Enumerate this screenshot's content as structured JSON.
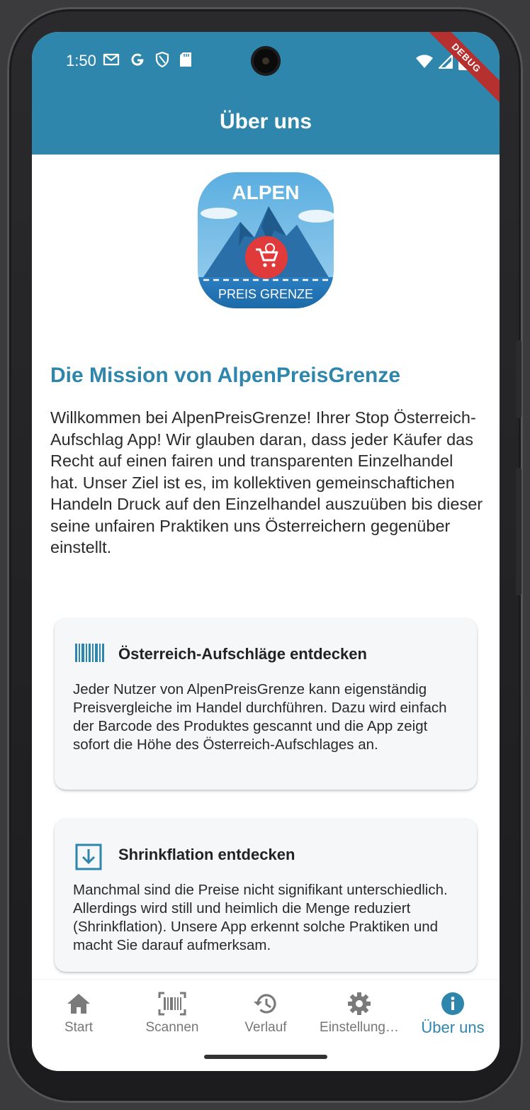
{
  "status_bar": {
    "time": "1:50",
    "icons": [
      "mail-icon",
      "google-icon",
      "shield-icon",
      "sd-card-icon",
      "wifi-icon",
      "signal-icon",
      "battery-icon"
    ],
    "debug_banner": "DEBUG"
  },
  "app_bar": {
    "title": "Über uns"
  },
  "colors": {
    "primary": "#2e86ad",
    "debug": "#b5302f",
    "card_bg": "#f6f7f9"
  },
  "logo": {
    "top_text": "ALPEN",
    "bottom_text": "PREIS GRENZE"
  },
  "mission": {
    "title": "Die Mission von AlpenPreisGrenze",
    "text": "Willkommen bei AlpenPreisGrenze! Ihrer Stop Österreich-Aufschlag App! Wir glauben daran, dass jeder Käufer das Recht auf einen fairen und transparenten Einzelhandel hat. Unser Ziel ist es, im kollektiven gemeinschaftichen Handeln Druck auf den Einzelhandel auszuüben bis dieser seine unfairen Praktiken uns Österreichern gegenüber einstellt."
  },
  "cards": [
    {
      "icon": "barcode-icon",
      "title": "Österreich-Aufschläge entdecken",
      "text": "Jeder Nutzer von AlpenPreisGrenze kann eigenständig Preisvergleiche im Handel durchführen. Dazu wird einfach der Barcode des Produktes gescannt und die App zeigt sofort die Höhe des Österreich-Aufschlages an."
    },
    {
      "icon": "download-box-icon",
      "title": "Shrinkflation entdecken",
      "text": "Manchmal sind die Preise nicht signifikant unterschiedlich. Allerdings wird still und heimlich die Menge reduziert (Shrinkflation). Unsere App erkennt solche Praktiken und macht Sie darauf aufmerksam."
    }
  ],
  "bottom_nav": {
    "items": [
      {
        "label": "Start",
        "icon": "home-icon"
      },
      {
        "label": "Scannen",
        "icon": "barcode-scan-icon"
      },
      {
        "label": "Verlauf",
        "icon": "history-icon"
      },
      {
        "label": "Einstellung…",
        "icon": "gear-icon"
      },
      {
        "label": "Über uns",
        "icon": "info-icon",
        "active": true
      }
    ]
  }
}
